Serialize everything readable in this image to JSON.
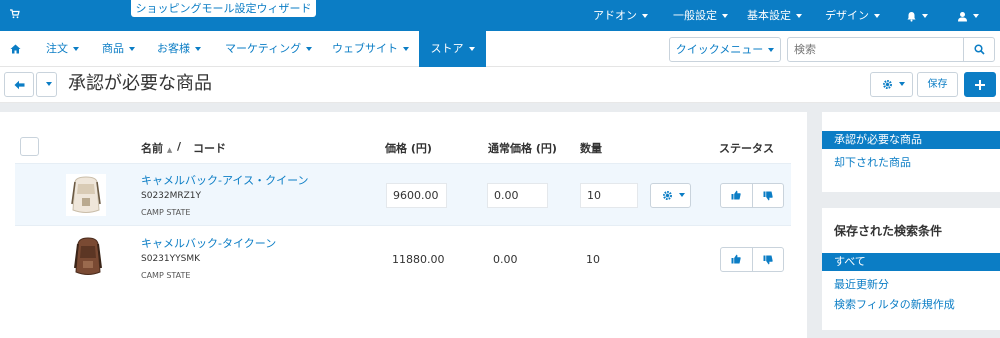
{
  "topbar": {
    "wizard_label": "ショッピングモール設定ウィザード",
    "menus": [
      "アドオン",
      "一般設定",
      "基本設定",
      "デザイン"
    ]
  },
  "nav": {
    "items": [
      "注文",
      "商品",
      "お客様",
      "マーケティング",
      "ウェブサイト",
      "ストア"
    ],
    "quick_menu": "クイックメニュー",
    "search_placeholder": "検索"
  },
  "page": {
    "title": "承認が必要な商品",
    "save_label": "保存"
  },
  "table": {
    "headers": {
      "name": "名前",
      "slash": "/",
      "code": "コード",
      "price": "価格 (円)",
      "list_price": "通常価格 (円)",
      "quantity": "数量",
      "status": "ステータス"
    },
    "rows": [
      {
        "name": "キャメルバック-アイス・クイーン",
        "code": "S0232MRZ1Y",
        "brand": "CAMP STATE",
        "price": "9600.00",
        "list_price": "0.00",
        "quantity": "10"
      },
      {
        "name": "キャメルバック-タイクーン",
        "code": "S0231YYSMK",
        "brand": "CAMP STATE",
        "price": "11880.00",
        "list_price": "0.00",
        "quantity": "10"
      }
    ]
  },
  "sidebar": {
    "filter_active": "承認が必要な商品",
    "filter_other": "却下された商品",
    "saved_title": "保存された検索条件",
    "saved_active": "すべて",
    "saved_items": [
      "最近更新分",
      "検索フィルタの新規作成"
    ]
  },
  "colors": {
    "accent": "#0b7dc5"
  }
}
